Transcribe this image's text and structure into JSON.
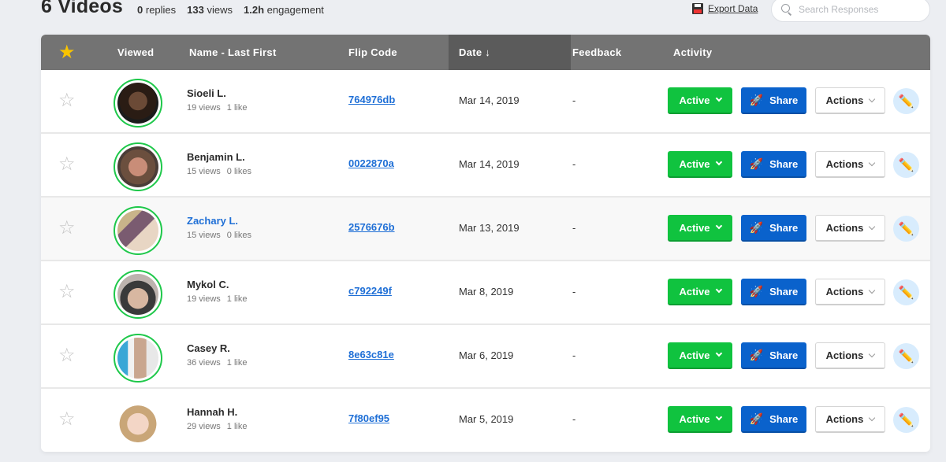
{
  "header": {
    "title": "6 Videos",
    "stats": [
      {
        "value": "0",
        "label": "replies"
      },
      {
        "value": "133",
        "label": "views"
      },
      {
        "value": "1.2h",
        "label": "engagement"
      }
    ],
    "export_label": "Export Data",
    "search_placeholder": "Search Responses",
    "search_value": ""
  },
  "table": {
    "columns": {
      "star": "★",
      "viewed": "Viewed",
      "name": "Name - Last First",
      "code": "Flip Code",
      "date": "Date ↓",
      "feedback": "Feedback",
      "activity": "Activity"
    },
    "sorted_column": "date",
    "rows": [
      {
        "name": "Sioeli L.",
        "views": "19 views",
        "likes": "1 like",
        "code": "764976db",
        "date": "Mar 14, 2019",
        "feedback": "-",
        "status": "Active",
        "share": "Share",
        "actions": "Actions",
        "highlight": false,
        "viewed": true
      },
      {
        "name": "Benjamin L.",
        "views": "15 views",
        "likes": "0 likes",
        "code": "0022870a",
        "date": "Mar 14, 2019",
        "feedback": "-",
        "status": "Active",
        "share": "Share",
        "actions": "Actions",
        "highlight": false,
        "viewed": true
      },
      {
        "name": "Zachary L.",
        "views": "15 views",
        "likes": "0 likes",
        "code": "2576676b",
        "date": "Mar 13, 2019",
        "feedback": "-",
        "status": "Active",
        "share": "Share",
        "actions": "Actions",
        "highlight": true,
        "viewed": true
      },
      {
        "name": "Mykol C.",
        "views": "19 views",
        "likes": "1 like",
        "code": "c792249f",
        "date": "Mar 8, 2019",
        "feedback": "-",
        "status": "Active",
        "share": "Share",
        "actions": "Actions",
        "highlight": false,
        "viewed": true
      },
      {
        "name": "Casey R.",
        "views": "36 views",
        "likes": "1 like",
        "code": "8e63c81e",
        "date": "Mar 6, 2019",
        "feedback": "-",
        "status": "Active",
        "share": "Share",
        "actions": "Actions",
        "highlight": false,
        "viewed": true
      },
      {
        "name": "Hannah H.",
        "views": "29 views",
        "likes": "1 like",
        "code": "7f80ef95",
        "date": "Mar 5, 2019",
        "feedback": "-",
        "status": "Active",
        "share": "Share",
        "actions": "Actions",
        "highlight": false,
        "viewed": false
      }
    ]
  },
  "icons": {
    "star_empty": "☆",
    "rocket": "🚀",
    "pencil": "✏️"
  },
  "colors": {
    "active_green": "#10c33f",
    "share_blue": "#0a62cc",
    "link_blue": "#1f6fd6",
    "viewed_ring": "#1ec84a",
    "header_gray": "#737373",
    "star_yellow": "#f9c400"
  }
}
